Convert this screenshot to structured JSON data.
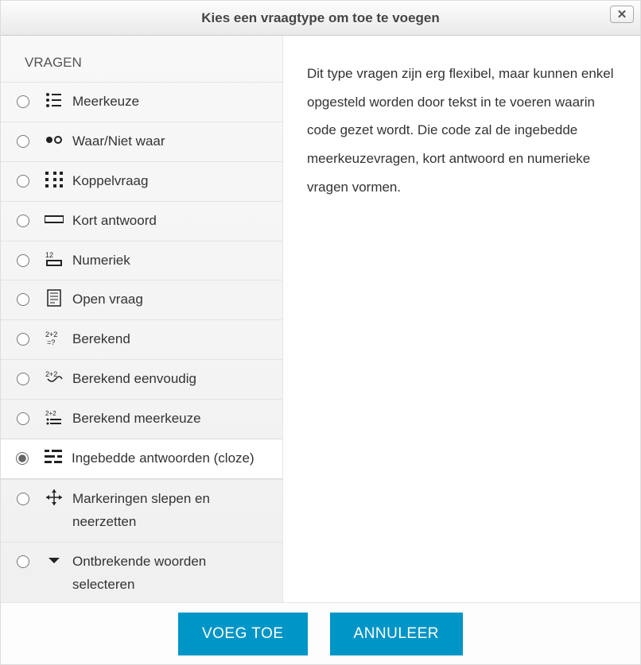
{
  "dialog": {
    "title": "Kies een vraagtype om toe te voegen"
  },
  "section_title": "VRAGEN",
  "question_types": [
    {
      "id": "meerkeuze",
      "label": "Meerkeuze",
      "icon": "list-icon",
      "selected": false
    },
    {
      "id": "waarnietwaar",
      "label": "Waar/Niet waar",
      "icon": "truefalse-icon",
      "selected": false
    },
    {
      "id": "koppelvraag",
      "label": "Koppelvraag",
      "icon": "match-icon",
      "selected": false
    },
    {
      "id": "kortantwoord",
      "label": "Kort antwoord",
      "icon": "shortanswer-icon",
      "selected": false
    },
    {
      "id": "numeriek",
      "label": "Numeriek",
      "icon": "numeric-icon",
      "selected": false
    },
    {
      "id": "openvraag",
      "label": "Open vraag",
      "icon": "essay-icon",
      "selected": false
    },
    {
      "id": "berekend",
      "label": "Berekend",
      "icon": "calculated-icon",
      "selected": false
    },
    {
      "id": "berekendeenvoudig",
      "label": "Berekend eenvoudig",
      "icon": "calculated-simple-icon",
      "selected": false
    },
    {
      "id": "berekendmeerkeuze",
      "label": "Berekend meerkeuze",
      "icon": "calculated-multi-icon",
      "selected": false
    },
    {
      "id": "ingebedde",
      "label": "Ingebedde antwoorden (cloze)",
      "icon": "cloze-icon",
      "selected": true
    },
    {
      "id": "markeringen",
      "label": "Markeringen slepen en neerzetten",
      "icon": "dragdrop-icon",
      "selected": false
    },
    {
      "id": "ontbrekende",
      "label": "Ontbrekende woorden selecteren",
      "icon": "select-missing-icon",
      "selected": false
    }
  ],
  "description": "Dit type vragen zijn erg flexibel, maar kunnen enkel opgesteld worden door tekst in te voeren waarin code gezet wordt. Die code zal de ingebedde meerkeuzevragen, kort antwoord en numerieke vragen vormen.",
  "buttons": {
    "add": "VOEG TOE",
    "cancel": "ANNULEER"
  }
}
